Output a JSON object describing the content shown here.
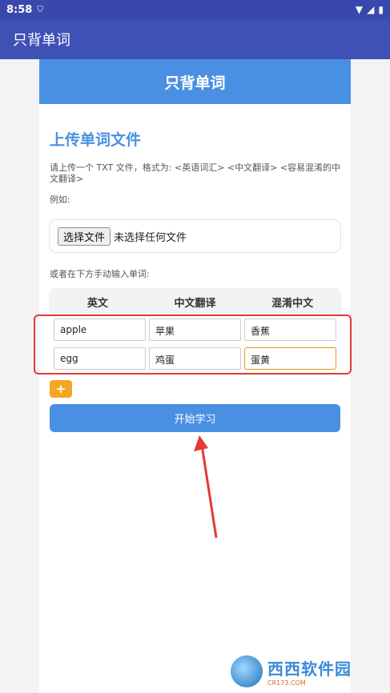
{
  "status": {
    "time": "8:58"
  },
  "appbar": {
    "title": "只背单词"
  },
  "card": {
    "header": "只背单词",
    "section_title": "上传单词文件",
    "description": "请上传一个 TXT 文件，格式为: <英语词汇> <中文翻译> <容易混淆的中文翻译>",
    "example": "例如:",
    "file_button": "选择文件",
    "file_status": "未选择任何文件",
    "manual": "或者在下方手动输入单词:",
    "columns": [
      "英文",
      "中文翻译",
      "混淆中文"
    ],
    "rows": [
      {
        "en": "apple",
        "zh": "苹果",
        "confuse": "香蕉"
      },
      {
        "en": "egg",
        "zh": "鸡蛋",
        "confuse": "蛋黄"
      }
    ],
    "add_label": "+",
    "start_label": "开始学习"
  },
  "watermark": {
    "brand": "西西软件园",
    "url": "CR173.COM"
  },
  "colors": {
    "accent": "#4a90e2",
    "appbar": "#3f51b5",
    "add": "#f5a623",
    "highlight": "#e53935"
  }
}
